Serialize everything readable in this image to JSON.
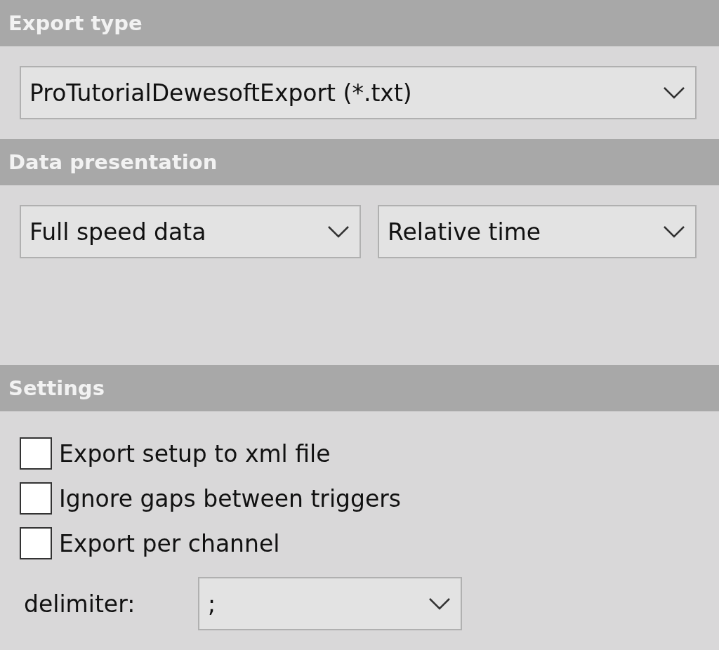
{
  "sections": [
    {
      "title": "Export type",
      "kind": "single",
      "dropdowns": [
        {
          "value": "ProTutorialDewesoftExport (*.txt)"
        }
      ]
    },
    {
      "title": "Data presentation",
      "kind": "pair",
      "dropdowns": [
        {
          "value": "Full speed data"
        },
        {
          "value": "Relative time"
        }
      ]
    },
    {
      "title": "Settings",
      "kind": "settings",
      "checkboxes": [
        {
          "label": "Export setup to xml file",
          "checked": false
        },
        {
          "label": "Ignore gaps between triggers",
          "checked": false
        },
        {
          "label": "Export per channel",
          "checked": false
        }
      ],
      "delimiter": {
        "label": "delimiter:",
        "value": ";"
      }
    }
  ]
}
